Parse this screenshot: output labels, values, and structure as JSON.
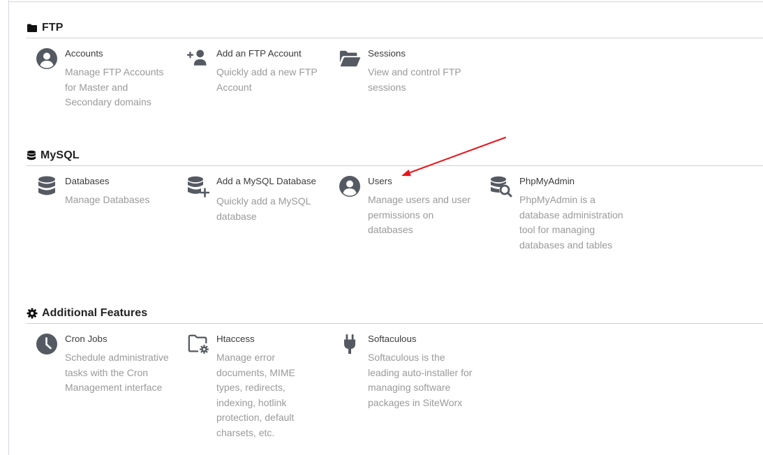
{
  "sections": {
    "ftp": {
      "title": "FTP",
      "icon": "folder-icon",
      "items": [
        {
          "title": "Accounts",
          "desc": "Manage FTP Accounts for Master and Secondary domains",
          "icon": "user-circle-icon"
        },
        {
          "title": "Add an FTP Account",
          "desc": "Quickly add a new FTP Account",
          "icon": "user-plus-icon"
        },
        {
          "title": "Sessions",
          "desc": "View and control FTP sessions",
          "icon": "folder-open-icon"
        }
      ]
    },
    "mysql": {
      "title": "MySQL",
      "icon": "database-icon",
      "items": [
        {
          "title": "Databases",
          "desc": "Manage Databases",
          "icon": "database-icon"
        },
        {
          "title": "Add a MySQL Database",
          "desc": "Quickly add a MySQL database",
          "icon": "database-plus-icon"
        },
        {
          "title": "Users",
          "desc": "Manage users and user permissions on databases",
          "icon": "user-circle-icon"
        },
        {
          "title": "PhpMyAdmin",
          "desc": "PhpMyAdmin is a database administration tool for managing databases and tables",
          "icon": "database-search-icon"
        }
      ]
    },
    "features": {
      "title": "Additional Features",
      "icon": "gear-icon",
      "items": [
        {
          "title": "Cron Jobs",
          "desc": "Schedule administrative tasks with the Cron Management interface",
          "icon": "clock-icon"
        },
        {
          "title": "Htaccess",
          "desc": "Manage error documents, MIME types, redirects, indexing, hotlink protection, default charsets, etc.",
          "icon": "folder-gear-icon"
        },
        {
          "title": "Softaculous",
          "desc": "Softaculous is the leading auto-installer for managing software packages in SiteWorx",
          "icon": "plug-icon"
        }
      ]
    }
  },
  "annotation": {
    "type": "arrow",
    "color": "#e8151b",
    "target": "Users"
  },
  "colors": {
    "icon": "#555a62",
    "title": "#3b3b3b",
    "description": "#9a9a9a",
    "rule": "#cfcfcf"
  }
}
